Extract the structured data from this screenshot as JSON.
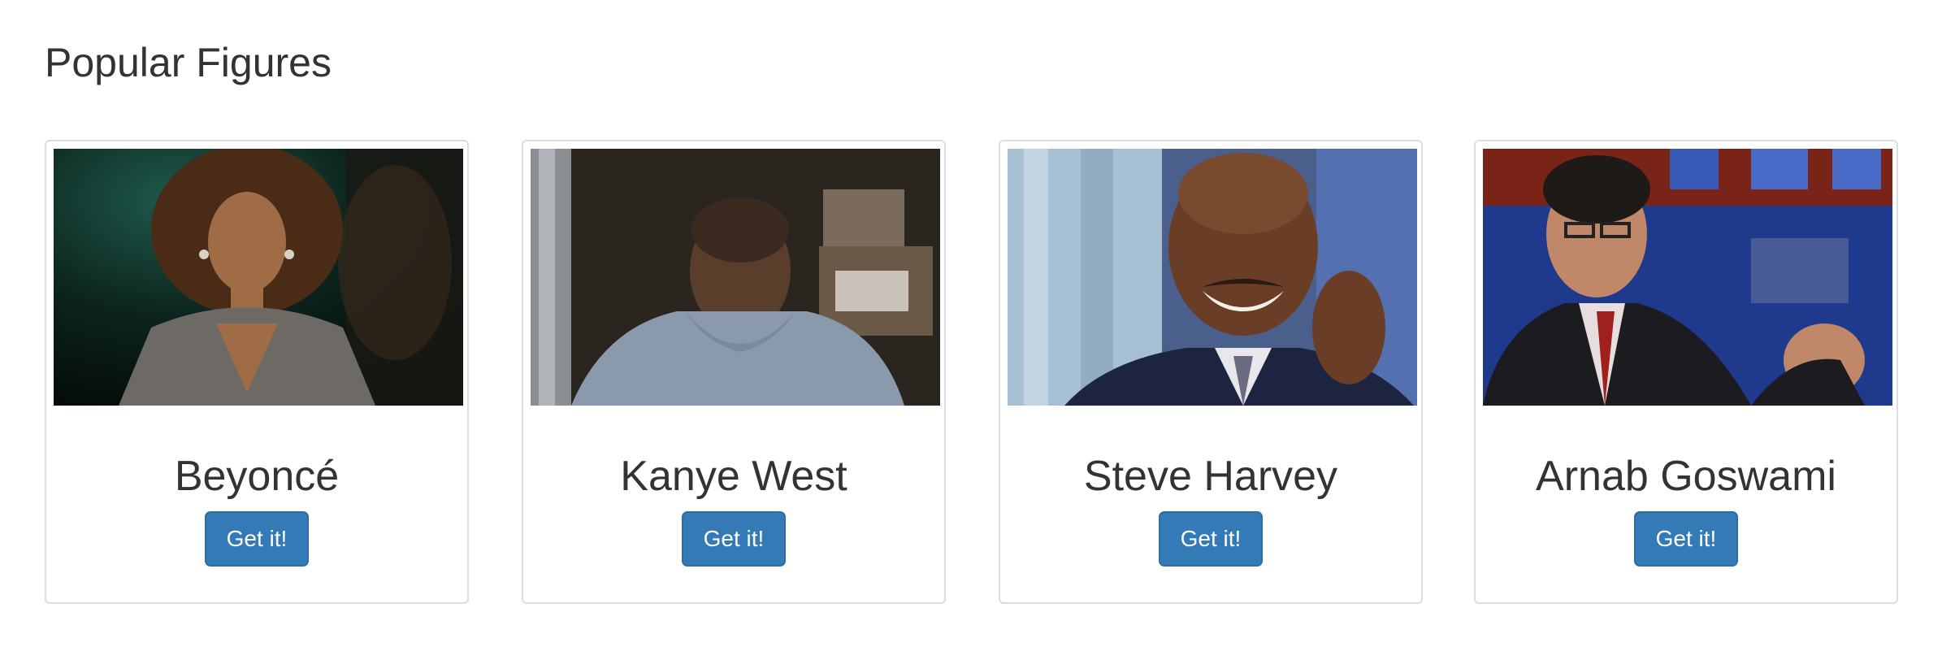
{
  "page": {
    "title": "Popular Figures"
  },
  "cards": [
    {
      "name": "Beyoncé",
      "button_label": "Get it!",
      "image_icon": "portrait-photo"
    },
    {
      "name": "Kanye West",
      "button_label": "Get it!",
      "image_icon": "portrait-photo"
    },
    {
      "name": "Steve Harvey",
      "button_label": "Get it!",
      "image_icon": "portrait-photo"
    },
    {
      "name": "Arnab Goswami",
      "button_label": "Get it!",
      "image_icon": "portrait-photo"
    }
  ],
  "colors": {
    "button_bg": "#337ab7",
    "button_border": "#2e6da4",
    "card_border": "#dddddd",
    "text": "#333333"
  }
}
